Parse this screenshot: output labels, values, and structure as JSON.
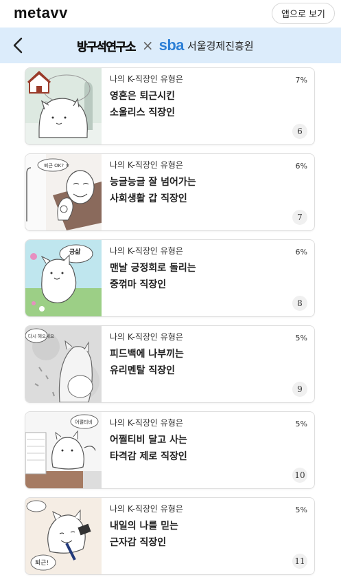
{
  "header": {
    "logo": "metavv",
    "app_button_label": "앱으로 보기"
  },
  "banner": {
    "partner_left": "방구석연구소",
    "separator": "×",
    "partner_right_mark": "sba",
    "partner_right_name": "서울경제진흥원",
    "background_color": "#dcecfb",
    "accent_color": "#2c7fd6"
  },
  "results": [
    {
      "kicker": "나의 K-직장인 유형은",
      "title_line1": "영혼은 퇴근시킨",
      "title_line2": "소울리스 직장인",
      "percent": "7%",
      "rank": "6",
      "thumb_text": ""
    },
    {
      "kicker": "나의 K-직장인 유형은",
      "title_line1": "능글능글 잘 넘어가는",
      "title_line2": "사회생활 갑 직장인",
      "percent": "6%",
      "rank": "7",
      "thumb_text": "퇴근 OK? ㅎ"
    },
    {
      "kicker": "나의 K-직장인 유형은",
      "title_line1": "맨날 긍정회로 돌리는",
      "title_line2": "중꺾마 직장인",
      "percent": "6%",
      "rank": "8",
      "thumb_text": "긍삶"
    },
    {
      "kicker": "나의 K-직장인 유형은",
      "title_line1": "피드백에 나부끼는",
      "title_line2": "유리멘탈 직장인",
      "percent": "5%",
      "rank": "9",
      "thumb_text": "다시 해오세요"
    },
    {
      "kicker": "나의 K-직장인 유형은",
      "title_line1": "어쩔티비 달고 사는",
      "title_line2": "타격감 제로 직장인",
      "percent": "5%",
      "rank": "10",
      "thumb_text": "어쩔티비"
    },
    {
      "kicker": "나의 K-직장인 유형은",
      "title_line1": "내일의 나를 믿는",
      "title_line2": "근자감 직장인",
      "percent": "5%",
      "rank": "11",
      "thumb_text": "퇴근!"
    }
  ]
}
